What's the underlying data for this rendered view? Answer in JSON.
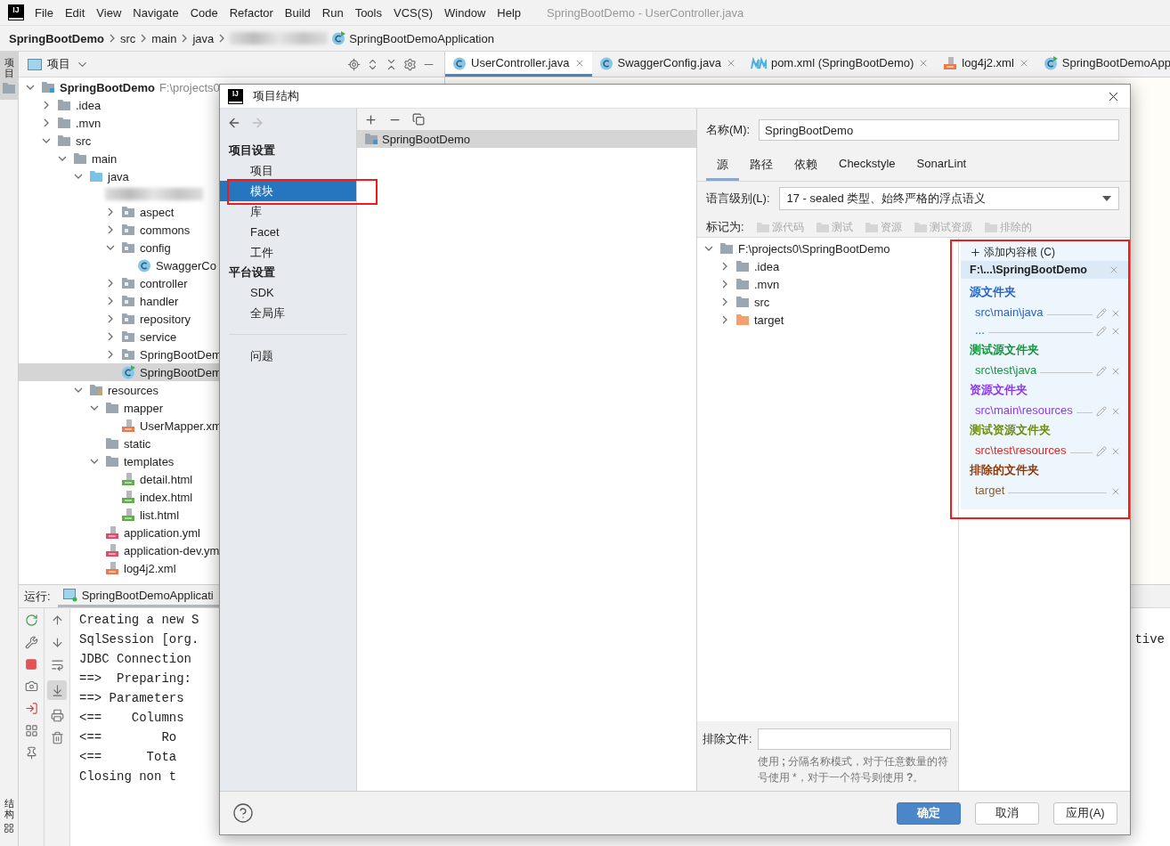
{
  "menu_bar": {
    "logo": "IJ",
    "items": [
      "File",
      "Edit",
      "View",
      "Navigate",
      "Code",
      "Refactor",
      "Build",
      "Run",
      "Tools",
      "VCS(S)",
      "Window",
      "Help"
    ],
    "title": "SpringBootDemo - UserController.java"
  },
  "breadcrumbs": [
    {
      "kind": "project",
      "label": "SpringBootDemo"
    },
    {
      "kind": "dir",
      "label": "src"
    },
    {
      "kind": "dir",
      "label": "main"
    },
    {
      "kind": "dir",
      "label": "java"
    },
    {
      "kind": "redacted"
    },
    {
      "kind": "class",
      "label": "SpringBootDemoApplication"
    }
  ],
  "left_stripe": {
    "top_tab": {
      "label": "项目",
      "selected": true
    },
    "bottom_tab": {
      "label": "结构",
      "selected": false
    }
  },
  "project_panel": {
    "title": "项目",
    "tree": [
      {
        "label": "SpringBootDemo",
        "path": "F:\\projects0",
        "kind": "project",
        "expanded": true,
        "selected": false,
        "children": [
          {
            "label": ".idea",
            "kind": "folder",
            "expanded": false,
            "selected": false
          },
          {
            "label": ".mvn",
            "kind": "folder",
            "expanded": false,
            "selected": false
          },
          {
            "label": "src",
            "kind": "folder",
            "expanded": true,
            "selected": false,
            "children": [
              {
                "label": "main",
                "kind": "folder",
                "expanded": true,
                "selected": false,
                "children": [
                  {
                    "label": "java",
                    "kind": "source",
                    "expanded": true,
                    "selected": false,
                    "children": [
                      {
                        "kind": "redacted",
                        "selected": false,
                        "children": [
                          {
                            "label": "aspect",
                            "kind": "package",
                            "expanded": false,
                            "selected": false
                          },
                          {
                            "label": "commons",
                            "kind": "package",
                            "expanded": false,
                            "selected": false
                          },
                          {
                            "label": "config",
                            "kind": "package",
                            "expanded": true,
                            "selected": false,
                            "children": [
                              {
                                "label": "SwaggerCo",
                                "kind": "class",
                                "selected": false
                              }
                            ]
                          },
                          {
                            "label": "controller",
                            "kind": "package",
                            "expanded": false,
                            "selected": false
                          },
                          {
                            "label": "handler",
                            "kind": "package",
                            "expanded": false,
                            "selected": false
                          },
                          {
                            "label": "repository",
                            "kind": "package",
                            "expanded": false,
                            "selected": false
                          },
                          {
                            "label": "service",
                            "kind": "package",
                            "expanded": false,
                            "selected": false
                          },
                          {
                            "label": "SpringBootDem",
                            "kind": "package",
                            "expanded": false,
                            "selected": false
                          },
                          {
                            "label": "SpringBootDem",
                            "kind": "main-class",
                            "selected": true
                          }
                        ]
                      }
                    ]
                  },
                  {
                    "label": "resources",
                    "kind": "resources",
                    "expanded": true,
                    "selected": false,
                    "children": [
                      {
                        "label": "mapper",
                        "kind": "folder",
                        "expanded": true,
                        "selected": false,
                        "children": [
                          {
                            "label": "UserMapper.xm",
                            "kind": "xml",
                            "selected": false
                          }
                        ]
                      },
                      {
                        "label": "static",
                        "kind": "folder",
                        "selected": false
                      },
                      {
                        "label": "templates",
                        "kind": "folder",
                        "expanded": true,
                        "selected": false,
                        "children": [
                          {
                            "label": "detail.html",
                            "kind": "html",
                            "selected": false
                          },
                          {
                            "label": "index.html",
                            "kind": "html",
                            "selected": false
                          },
                          {
                            "label": "list.html",
                            "kind": "html",
                            "selected": false
                          }
                        ]
                      },
                      {
                        "label": "application.yml",
                        "kind": "yml",
                        "selected": false
                      },
                      {
                        "label": "application-dev.ym",
                        "kind": "yml",
                        "selected": false
                      },
                      {
                        "label": "log4j2.xml",
                        "kind": "xml",
                        "selected": false
                      }
                    ]
                  }
                ]
              }
            ]
          }
        ]
      }
    ]
  },
  "editor_tabs": [
    {
      "label": "UserController.java",
      "kind": "class",
      "selected": true
    },
    {
      "label": "SwaggerConfig.java",
      "kind": "class",
      "selected": false
    },
    {
      "label": "pom.xml (SpringBootDemo)",
      "kind": "maven",
      "selected": false
    },
    {
      "label": "log4j2.xml",
      "kind": "xml",
      "selected": false
    },
    {
      "label": "SpringBootDemoApp",
      "kind": "main-class",
      "selected": false
    }
  ],
  "run_panel": {
    "label": "运行:",
    "tab": "SpringBootDemoApplicati",
    "scroll_to_end_on": true,
    "console": [
      {
        "text": "Creating a new S"
      },
      {
        "text": "SqlSession [org.",
        "tail": "tive"
      },
      {
        "text": "JDBC Connection"
      },
      {
        "text": "==>  Preparing:"
      },
      {
        "text": "==> Parameters"
      },
      {
        "text": "<==    Columns"
      },
      {
        "text": "<==        Ro"
      },
      {
        "text": "<==      Tota"
      },
      {
        "text": "Closing non t"
      }
    ]
  },
  "dialog": {
    "logo": "IJ",
    "title": "项目结构",
    "nav": [
      {
        "kind": "header",
        "label": "项目设置"
      },
      {
        "kind": "item",
        "label": "项目",
        "selected": false,
        "highlighted": false
      },
      {
        "kind": "item",
        "label": "模块",
        "selected": true,
        "highlighted": true
      },
      {
        "kind": "item",
        "label": "库",
        "selected": false,
        "highlighted": false
      },
      {
        "kind": "item",
        "label": "Facet",
        "selected": false,
        "highlighted": false
      },
      {
        "kind": "item",
        "label": "工件",
        "selected": false,
        "highlighted": false
      },
      {
        "kind": "header",
        "label": "平台设置"
      },
      {
        "kind": "item",
        "label": "SDK",
        "selected": false,
        "highlighted": false
      },
      {
        "kind": "item",
        "label": "全局库",
        "selected": false,
        "highlighted": false
      },
      {
        "kind": "divider"
      },
      {
        "kind": "item",
        "label": "问题",
        "selected": false,
        "highlighted": false
      }
    ],
    "modules": [
      {
        "label": "SpringBootDemo",
        "selected": true
      }
    ],
    "name_label": "名称(M):",
    "name_value": "SpringBootDemo",
    "tabs": [
      {
        "label": "源",
        "selected": true
      },
      {
        "label": "路径",
        "selected": false
      },
      {
        "label": "依赖",
        "selected": false
      },
      {
        "label": "Checkstyle",
        "selected": false
      },
      {
        "label": "SonarLint",
        "selected": false
      }
    ],
    "language_label": "语言级别(L):",
    "language_value": "17 - sealed 类型、始终严格的浮点语义",
    "mark_label": "标记为:",
    "mark_buttons": [
      {
        "label": "源代码",
        "disabled": true
      },
      {
        "label": "测试",
        "disabled": true
      },
      {
        "label": "资源",
        "disabled": true
      },
      {
        "label": "测试资源",
        "disabled": true
      },
      {
        "label": "排除的",
        "disabled": true
      }
    ],
    "folder_tree": [
      {
        "label": "F:\\projects0\\SpringBootDemo",
        "kind": "folder",
        "expanded": true,
        "children": [
          {
            "label": ".idea",
            "kind": "folder",
            "expanded": false
          },
          {
            "label": ".mvn",
            "kind": "folder",
            "expanded": false
          },
          {
            "label": "src",
            "kind": "folder",
            "expanded": false
          },
          {
            "label": "target",
            "kind": "excluded",
            "expanded": false
          }
        ]
      }
    ],
    "exclude_label": "排除文件:",
    "exclude_hint": "使用 **;** 分隔名称模式，对于任意数量的符号使用 *，对于一个符号则使用 **?**。",
    "content_roots": {
      "highlighted": true,
      "add_label": "添加内容根 (C)",
      "root": "F:\\...\\SpringBootDemo",
      "groups": [
        {
          "title": "源文件夹",
          "color": "#2a64c4",
          "entries": [
            {
              "path": "src\\main\\java",
              "color": "#2a64c4",
              "editable": true
            },
            {
              "path": "...",
              "editable": true
            }
          ]
        },
        {
          "title": "测试源文件夹",
          "color": "#12963c",
          "entries": [
            {
              "path": "src\\test\\java",
              "color": "#12963c",
              "editable": true
            }
          ]
        },
        {
          "title": "资源文件夹",
          "color": "#8a3ae8",
          "entries": [
            {
              "path": "src\\main\\resources",
              "color": "#8a3ae8",
              "editable": true
            }
          ]
        },
        {
          "title": "测试资源文件夹",
          "color": "#6e8c10",
          "entries": [
            {
              "path": "src\\test\\resources",
              "color": "#e5221b",
              "editable": true
            }
          ]
        },
        {
          "title": "排除的文件夹",
          "color": "#8c3a0a",
          "entries": [
            {
              "path": "target",
              "color": "#8a5a30",
              "editable": false
            }
          ]
        }
      ]
    },
    "buttons": [
      {
        "label": "确定",
        "kind": "primary"
      },
      {
        "label": "取消",
        "kind": "default"
      },
      {
        "label": "应用(A)",
        "kind": "default"
      }
    ]
  }
}
